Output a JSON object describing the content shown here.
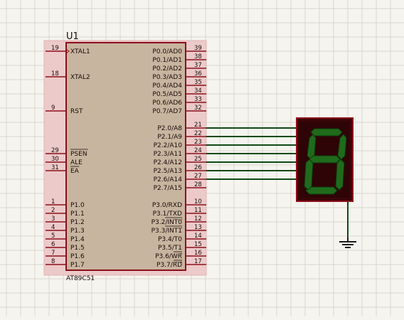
{
  "schematic": {
    "ref": "U1",
    "part": "AT89C51",
    "left_pins": [
      {
        "num": "19",
        "name": "XTAL1",
        "clock": true
      },
      {
        "num": "18",
        "name": "XTAL2"
      },
      {
        "num": "9",
        "name": "RST"
      },
      {
        "num": "29",
        "name": "PSEN",
        "overline": true
      },
      {
        "num": "30",
        "name": "ALE"
      },
      {
        "num": "31",
        "name": "EA",
        "overline": true
      },
      {
        "num": "1",
        "name": "P1.0"
      },
      {
        "num": "2",
        "name": "P1.1"
      },
      {
        "num": "3",
        "name": "P1.2"
      },
      {
        "num": "4",
        "name": "P1.3"
      },
      {
        "num": "5",
        "name": "P1.4"
      },
      {
        "num": "6",
        "name": "P1.5"
      },
      {
        "num": "7",
        "name": "P1.6"
      },
      {
        "num": "8",
        "name": "P1.7"
      }
    ],
    "right_pins": [
      {
        "num": "39",
        "name": "P0.0/AD0"
      },
      {
        "num": "38",
        "name": "P0.1/AD1"
      },
      {
        "num": "37",
        "name": "P0.2/AD2"
      },
      {
        "num": "36",
        "name": "P0.3/AD3"
      },
      {
        "num": "35",
        "name": "P0.4/AD4"
      },
      {
        "num": "34",
        "name": "P0.5/AD5"
      },
      {
        "num": "33",
        "name": "P0.6/AD6"
      },
      {
        "num": "32",
        "name": "P0.7/AD7"
      },
      {
        "num": "21",
        "name": "P2.0/A8"
      },
      {
        "num": "22",
        "name": "P2.1/A9"
      },
      {
        "num": "23",
        "name": "P2.2/A10"
      },
      {
        "num": "24",
        "name": "P2.3/A11"
      },
      {
        "num": "25",
        "name": "P2.4/A12"
      },
      {
        "num": "26",
        "name": "P2.5/A13"
      },
      {
        "num": "27",
        "name": "P2.6/A14"
      },
      {
        "num": "28",
        "name": "P2.7/A15"
      },
      {
        "num": "10",
        "name": "P3.0/RXD"
      },
      {
        "num": "11",
        "name": "P3.1/TXD"
      },
      {
        "num": "12",
        "name": "P3.2/",
        "over": "INT0"
      },
      {
        "num": "13",
        "name": "P3.3/",
        "over": "INT1"
      },
      {
        "num": "14",
        "name": "P3.4/T0"
      },
      {
        "num": "15",
        "name": "P3.5/T1"
      },
      {
        "num": "16",
        "name": "P3.6/",
        "over": "WR"
      },
      {
        "num": "17",
        "name": "P3.7/",
        "over": "RD"
      }
    ],
    "display": {
      "digit_shown": "8",
      "connected_pins": [
        "21",
        "22",
        "23",
        "24",
        "25",
        "26",
        "27"
      ]
    },
    "colors": {
      "grid": "#d9d7cc",
      "chip_body": "#c8b59f",
      "chip_highlight": "#eccaca",
      "outline": "#8b0e1a",
      "wire": "#0d4a12",
      "segment_on": "#1f6b1b",
      "display_bg": "#3a0508"
    }
  }
}
